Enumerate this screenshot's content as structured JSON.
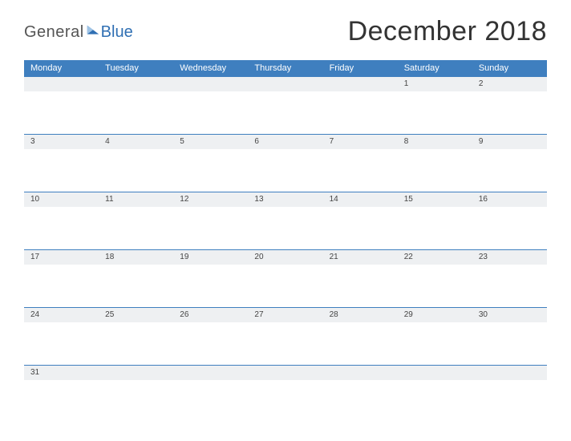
{
  "logo": {
    "part1": "General",
    "part2": "Blue"
  },
  "title": "December 2018",
  "days": [
    "Monday",
    "Tuesday",
    "Wednesday",
    "Thursday",
    "Friday",
    "Saturday",
    "Sunday"
  ],
  "weeks": [
    [
      "",
      "",
      "",
      "",
      "",
      "1",
      "2"
    ],
    [
      "3",
      "4",
      "5",
      "6",
      "7",
      "8",
      "9"
    ],
    [
      "10",
      "11",
      "12",
      "13",
      "14",
      "15",
      "16"
    ],
    [
      "17",
      "18",
      "19",
      "20",
      "21",
      "22",
      "23"
    ],
    [
      "24",
      "25",
      "26",
      "27",
      "28",
      "29",
      "30"
    ],
    [
      "31",
      "",
      "",
      "",
      "",
      "",
      ""
    ]
  ]
}
